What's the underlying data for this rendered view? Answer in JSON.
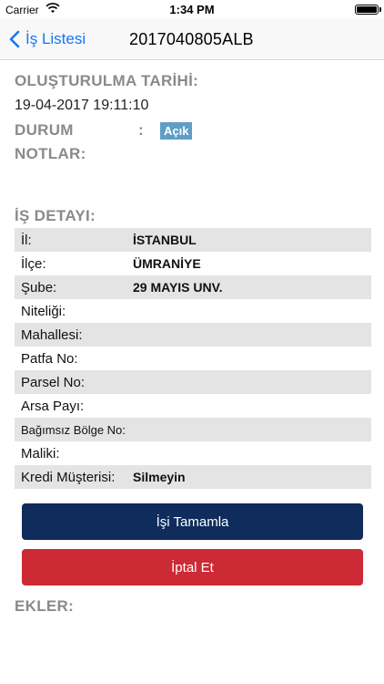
{
  "status_bar": {
    "carrier": "Carrier",
    "time": "1:34 PM"
  },
  "nav": {
    "back_label": "İş Listesi",
    "title": "2017040805ALB"
  },
  "creation": {
    "label": "OLUŞTURULMA TARİHİ:",
    "value": "19-04-2017 19:11:10"
  },
  "status": {
    "label": "DURUM",
    "colon": ":",
    "value": "Açık",
    "badge_color": "#5e9ec6"
  },
  "notes": {
    "label": "NOTLAR:"
  },
  "details": {
    "label": "İŞ DETAYI:",
    "rows": [
      {
        "key": "İl:",
        "value": "İSTANBUL"
      },
      {
        "key": "İlçe:",
        "value": "ÜMRANİYE"
      },
      {
        "key": "Şube:",
        "value": "29 MAYIS UNV."
      },
      {
        "key": "Niteliği:",
        "value": ""
      },
      {
        "key": "Mahallesi:",
        "value": ""
      },
      {
        "key": "Patfa No:",
        "value": ""
      },
      {
        "key": "Parsel No:",
        "value": ""
      },
      {
        "key": "Arsa Payı:",
        "value": ""
      },
      {
        "key": "Bağımsız Bölge No:",
        "value": ""
      },
      {
        "key": "Maliki:",
        "value": ""
      },
      {
        "key": "Kredi Müşterisi:",
        "value": "Silmeyin"
      }
    ]
  },
  "actions": {
    "complete_label": "İşi Tamamla",
    "complete_color": "#0f2c5c",
    "cancel_label": "İptal Et",
    "cancel_color": "#cc2a34"
  },
  "attachments": {
    "label": "EKLER:"
  }
}
